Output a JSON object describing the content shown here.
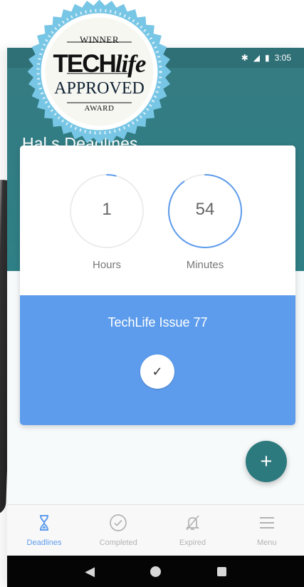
{
  "status": {
    "time": "3:05",
    "icons": [
      "bluetooth-icon",
      "signal-icon",
      "battery-icon"
    ]
  },
  "award": {
    "winner": "WINNER",
    "brand_main": "TECH",
    "brand_accent": "life",
    "approved": "APPROVED",
    "label": "AWARD"
  },
  "header": {
    "title": "Hal        s Deadlines"
  },
  "timers": [
    {
      "value": "1",
      "label": "Hours",
      "progress": 0.04
    },
    {
      "value": "54",
      "label": "Minutes",
      "progress": 0.9
    }
  ],
  "deadline": {
    "title": "TechLife Issue 77",
    "action_icon": "check-icon"
  },
  "fab": {
    "label": "+"
  },
  "bottom_nav": [
    {
      "label": "Deadlines",
      "icon": "hourglass-icon",
      "active": true
    },
    {
      "label": "Completed",
      "icon": "check-circle-icon",
      "active": false
    },
    {
      "label": "Expired",
      "icon": "bell-off-icon",
      "active": false
    },
    {
      "label": "Menu",
      "icon": "menu-icon",
      "active": false
    }
  ],
  "system_nav": {
    "back": "◀",
    "home": "home-icon",
    "recent": "recent-apps-icon"
  },
  "colors": {
    "teal": "#2f7d84",
    "blue": "#5d9cec",
    "timer_grey": "#e8e8e8"
  }
}
